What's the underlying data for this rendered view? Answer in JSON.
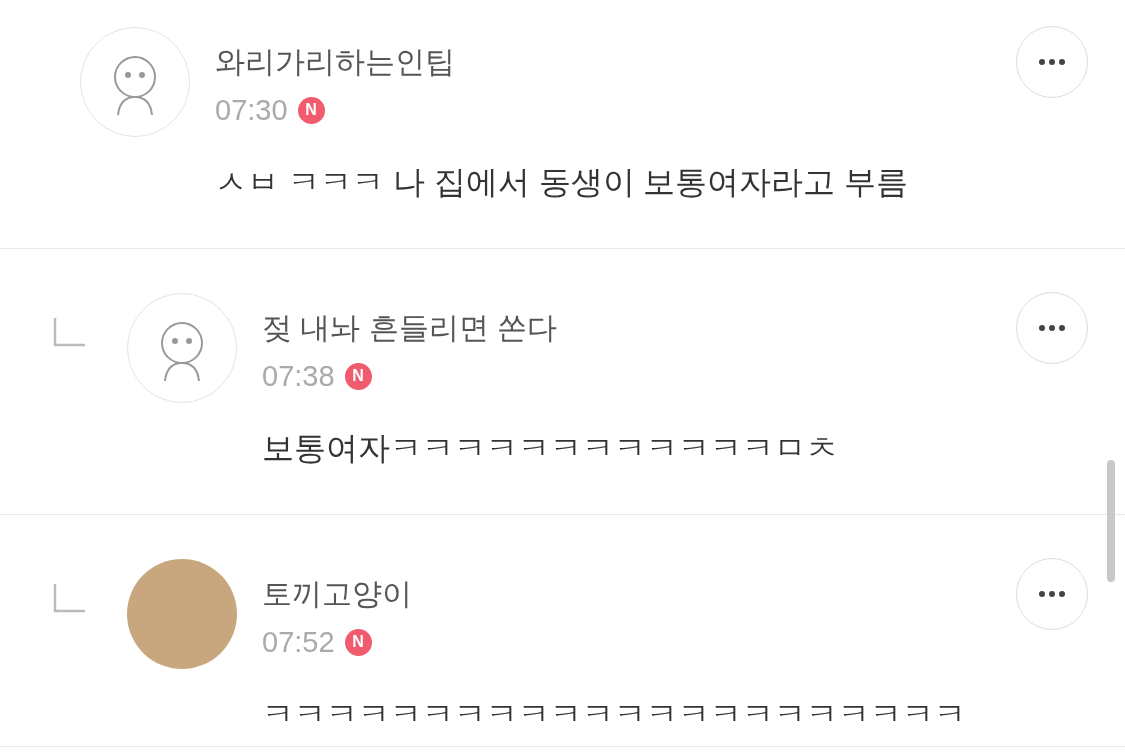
{
  "comments": [
    {
      "kind": "top",
      "avatar": {
        "kind": "character"
      },
      "author": "와리가리하는인팁",
      "time": "07:30",
      "badge": "N",
      "text": "ㅅㅂ ㅋㅋㅋ 나 집에서 동생이 보통여자라고 부름"
    },
    {
      "kind": "reply",
      "avatar": {
        "kind": "character"
      },
      "author": "젖 내놔 흔들리면 쏜다",
      "time": "07:38",
      "badge": "N",
      "text": "보통여자ㅋㅋㅋㅋㅋㅋㅋㅋㅋㅋㅋㅋㅁㅊ"
    },
    {
      "kind": "reply",
      "avatar": {
        "kind": "photo"
      },
      "author": "토끼고양이",
      "time": "07:52",
      "badge": "N",
      "text": "ㅋㅋㅋㅋㅋㅋㅋㅋㅋㅋㅋㅋㅋㅋㅋㅋㅋㅋㅋㅋㅋㅋ"
    }
  ]
}
